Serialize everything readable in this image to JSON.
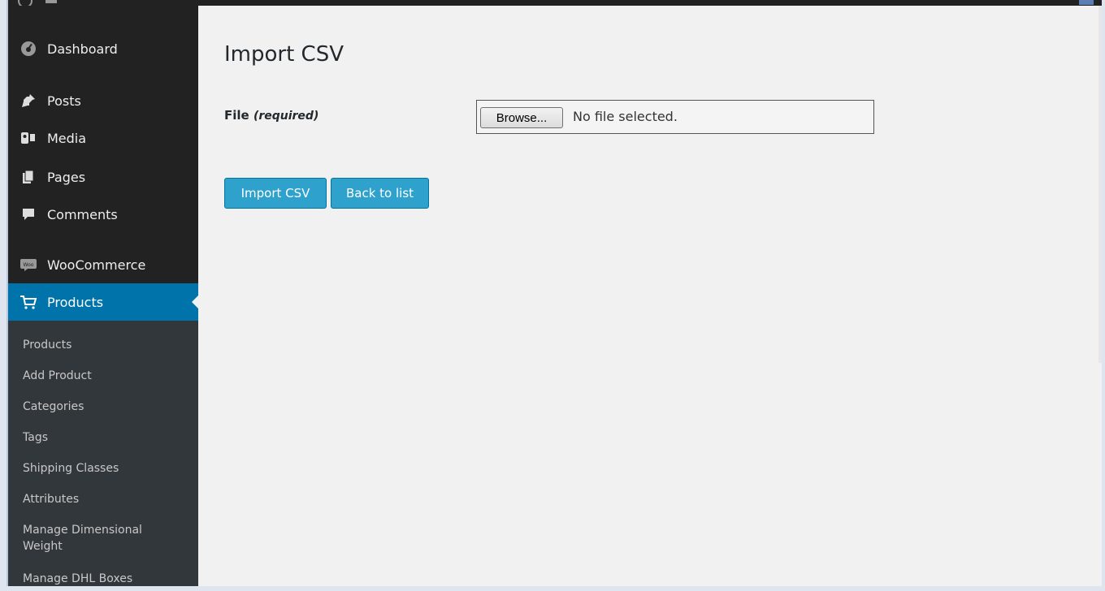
{
  "sidebar": {
    "items": [
      {
        "label": "Dashboard",
        "icon": "dashboard-icon"
      },
      {
        "label": "Posts",
        "icon": "pin-icon"
      },
      {
        "label": "Media",
        "icon": "media-icon"
      },
      {
        "label": "Pages",
        "icon": "pages-icon"
      },
      {
        "label": "Comments",
        "icon": "comment-icon"
      },
      {
        "label": "WooCommerce",
        "icon": "woo-icon"
      },
      {
        "label": "Products",
        "icon": "cart-icon",
        "active": true
      }
    ],
    "submenu": [
      "Products",
      "Add Product",
      "Categories",
      "Tags",
      "Shipping Classes",
      "Attributes",
      "Manage Dimensional Weight",
      "Manage DHL Boxes"
    ]
  },
  "main": {
    "title": "Import CSV",
    "file_label": "File",
    "file_required": "(required)",
    "browse_label": "Browse...",
    "file_status": "No file selected.",
    "import_button": "Import CSV",
    "back_button": "Back to list"
  },
  "colors": {
    "sidebar_bg": "#222222",
    "submenu_bg": "#32373c",
    "active_bg": "#0073aa",
    "button_bg": "#2ea2cc"
  }
}
